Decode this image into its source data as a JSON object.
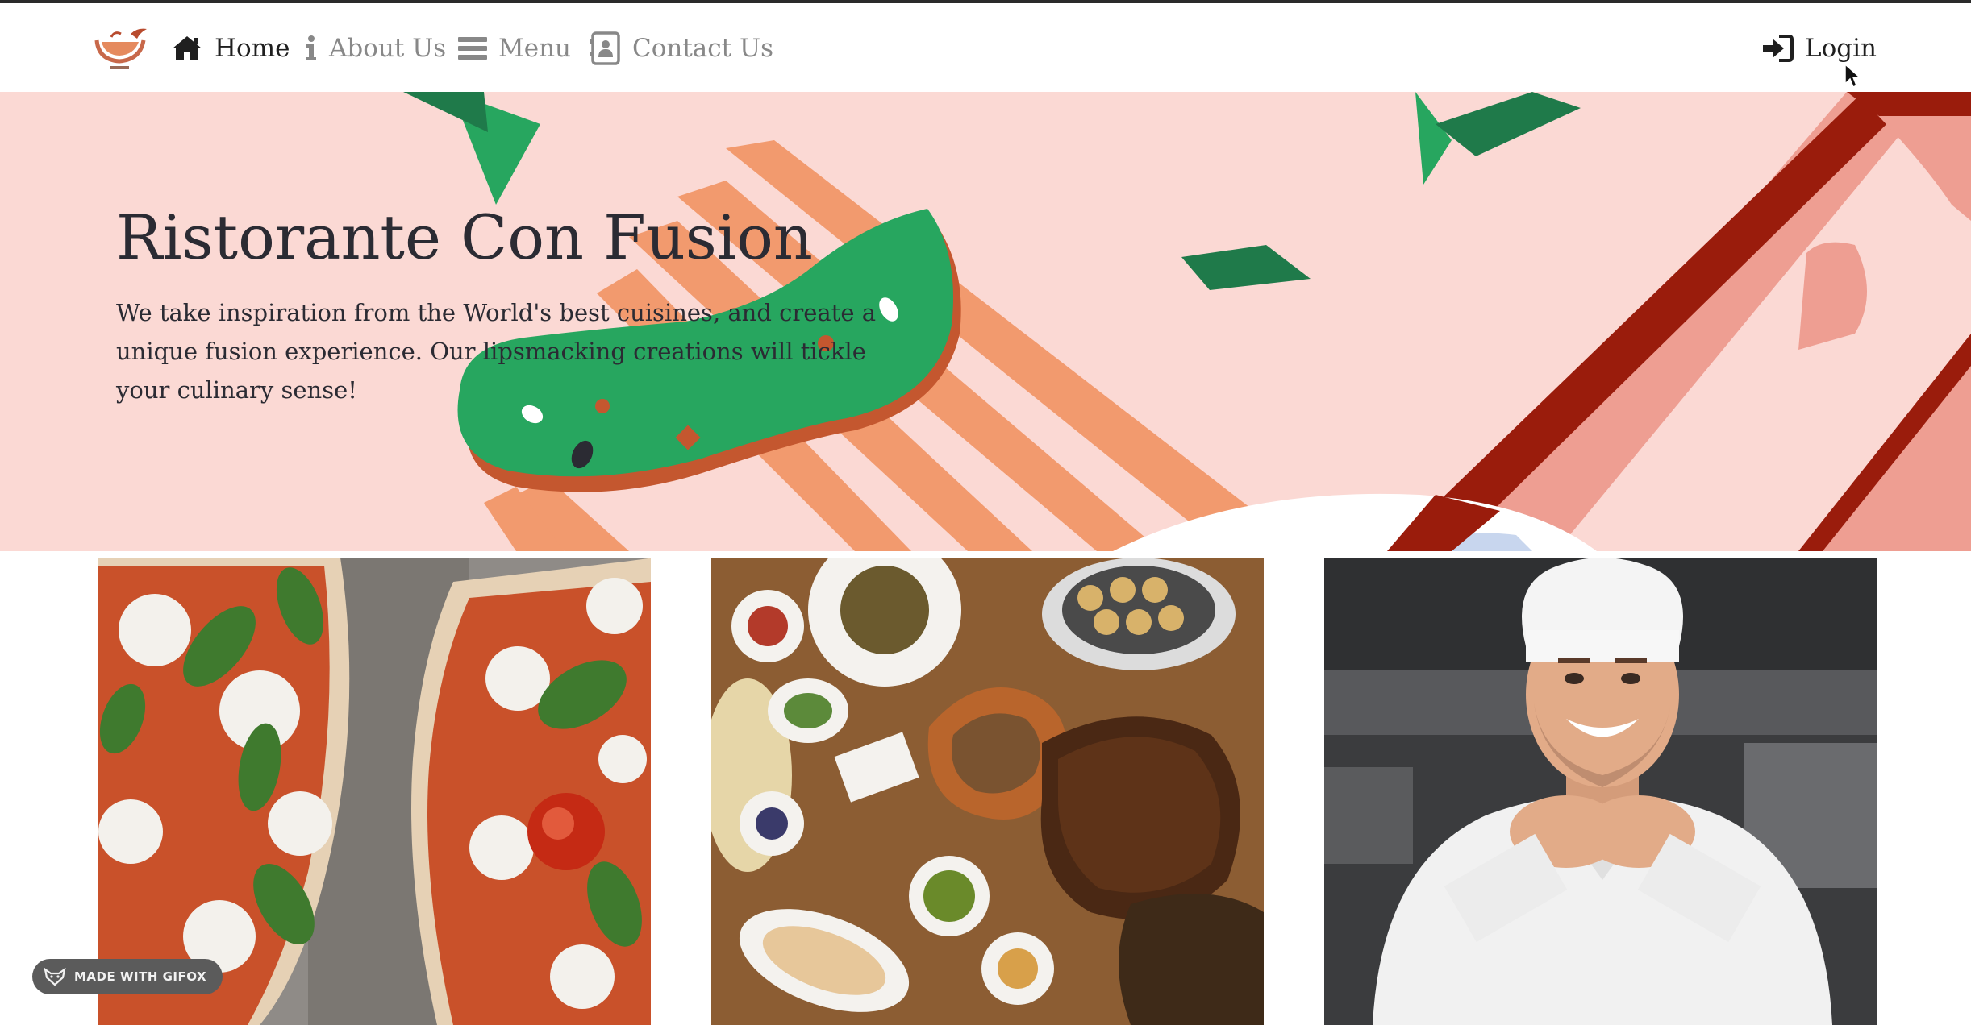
{
  "navbar": {
    "items": [
      {
        "label": "Home",
        "icon": "home-icon",
        "active": true
      },
      {
        "label": "About Us",
        "icon": "info-icon",
        "active": false
      },
      {
        "label": "Menu",
        "icon": "list-icon",
        "active": false
      },
      {
        "label": "Contact Us",
        "icon": "address-card-icon",
        "active": false
      }
    ],
    "login": {
      "label": "Login",
      "icon": "sign-in-icon"
    }
  },
  "jumbotron": {
    "title": "Ristorante Con Fusion",
    "text": "We take inspiration from the World's best cuisines, and create a unique fusion experience. Our lipsmacking creations will tickle your culinary sense!"
  },
  "cards": [
    {
      "image": "pizza-photo"
    },
    {
      "image": "buffet-dishes-photo"
    },
    {
      "image": "chef-photo"
    }
  ],
  "badge": {
    "label": "MADE WITH GIFOX"
  },
  "colors": {
    "hero_background": "#fbd9d4",
    "accent_green": "#27a65f",
    "accent_dark_red": "#9a1c0c",
    "accent_orange": "#f29a6e",
    "nav_active": "#1f1f1f",
    "nav_inactive": "#888888"
  }
}
